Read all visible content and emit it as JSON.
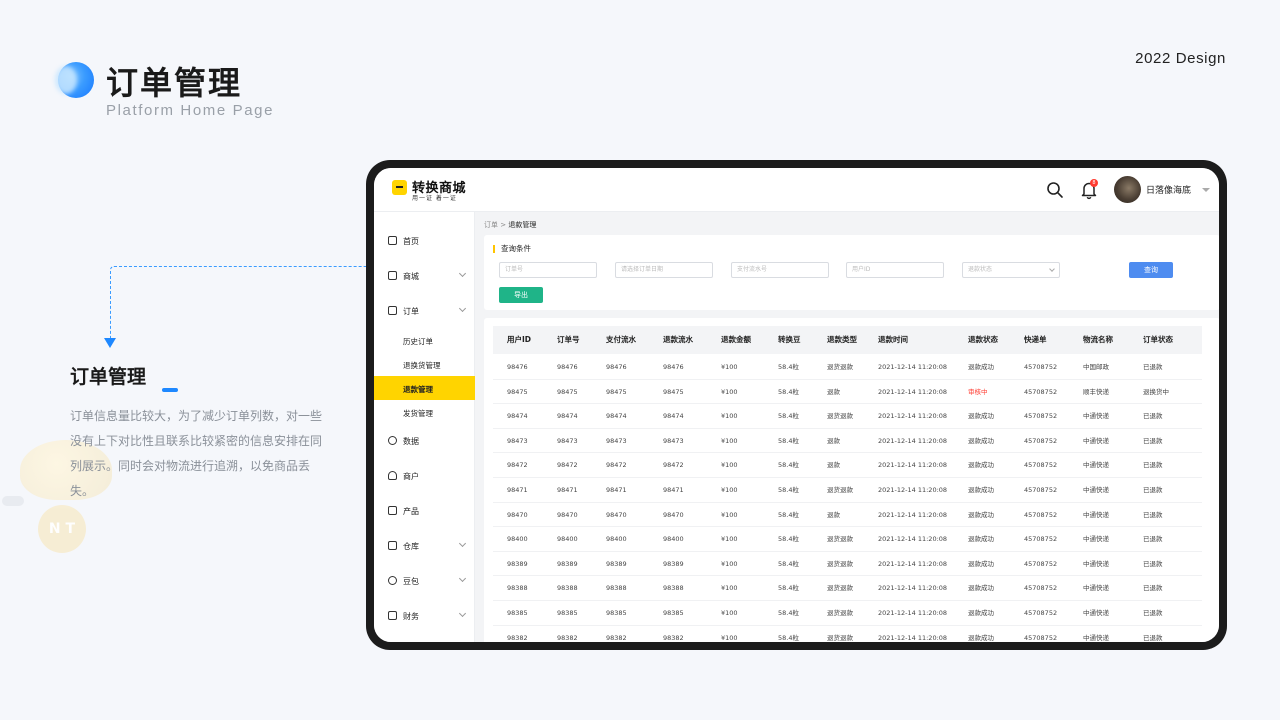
{
  "page": {
    "title": "订单管理",
    "subtitle": "Platform Home Page",
    "year_label": "2022 Design",
    "section_title": "订单管理",
    "section_desc": "订单信息量比较大，为了减少订单列数，对一些没有上下对比性且联系比较紧密的信息安排在同列展示。同时会对物流进行追溯，以免商品丢失。",
    "deco_coin_text": "N T"
  },
  "app": {
    "logo_title": "转换商城",
    "logo_sub": "用一证 着一证",
    "notification_count": "8",
    "user_name": "日落像海底"
  },
  "sidebar": {
    "items": [
      {
        "label": "首页",
        "icon": "home-icon",
        "has_children": false
      },
      {
        "label": "商城",
        "icon": "store-icon",
        "has_children": true
      },
      {
        "label": "订单",
        "icon": "order-icon",
        "has_children": true
      }
    ],
    "sub_items": [
      {
        "label": "历史订单",
        "active": false
      },
      {
        "label": "退换货管理",
        "active": false
      },
      {
        "label": "退款管理",
        "active": true
      },
      {
        "label": "发货管理",
        "active": false
      }
    ],
    "items_after": [
      {
        "label": "数据",
        "icon": "data-icon",
        "has_children": false
      },
      {
        "label": "商户",
        "icon": "merchant-icon",
        "has_children": false
      },
      {
        "label": "产品",
        "icon": "product-icon",
        "has_children": false
      },
      {
        "label": "仓库",
        "icon": "warehouse-icon",
        "has_children": true
      },
      {
        "label": "豆包",
        "icon": "bean-icon",
        "has_children": true
      },
      {
        "label": "财务",
        "icon": "finance-icon",
        "has_children": true
      }
    ]
  },
  "breadcrumb": {
    "parent": "订单",
    "separator": ">",
    "current": "退款管理"
  },
  "filter": {
    "title": "查询条件",
    "inputs": [
      {
        "placeholder": "订单号"
      },
      {
        "placeholder": "请选择订单日期"
      },
      {
        "placeholder": "支付流水号"
      },
      {
        "placeholder": "用户ID"
      },
      {
        "placeholder": "退款状态",
        "is_select": true
      }
    ],
    "query_label": "查询",
    "export_label": "导出"
  },
  "table": {
    "columns": [
      "用户ID",
      "订单号",
      "支付流水",
      "退款流水",
      "退款金额",
      "转换豆",
      "退款类型",
      "退款时间",
      "退款状态",
      "快递单",
      "物流名称",
      "订单状态"
    ],
    "rows": [
      [
        "98476",
        "98476",
        "98476",
        "98476",
        "¥100",
        "58.4粒",
        "退货退款",
        "2021-12-14 11:20:08",
        "退款成功",
        "45708752",
        "中国邮政",
        "已退款"
      ],
      [
        "98475",
        "98475",
        "98475",
        "98475",
        "¥100",
        "58.4粒",
        "退款",
        "2021-12-14 11:20:08",
        "审核中",
        "45708752",
        "顺丰快递",
        "退换货中"
      ],
      [
        "98474",
        "98474",
        "98474",
        "98474",
        "¥100",
        "58.4粒",
        "退货退款",
        "2021-12-14 11:20:08",
        "退款成功",
        "45708752",
        "中通快递",
        "已退款"
      ],
      [
        "98473",
        "98473",
        "98473",
        "98473",
        "¥100",
        "58.4粒",
        "退款",
        "2021-12-14 11:20:08",
        "退款成功",
        "45708752",
        "中通快递",
        "已退款"
      ],
      [
        "98472",
        "98472",
        "98472",
        "98472",
        "¥100",
        "58.4粒",
        "退款",
        "2021-12-14 11:20:08",
        "退款成功",
        "45708752",
        "中通快递",
        "已退款"
      ],
      [
        "98471",
        "98471",
        "98471",
        "98471",
        "¥100",
        "58.4粒",
        "退货退款",
        "2021-12-14 11:20:08",
        "退款成功",
        "45708752",
        "中通快递",
        "已退款"
      ],
      [
        "98470",
        "98470",
        "98470",
        "98470",
        "¥100",
        "58.4粒",
        "退款",
        "2021-12-14 11:20:08",
        "退款成功",
        "45708752",
        "中通快递",
        "已退款"
      ],
      [
        "98400",
        "98400",
        "98400",
        "98400",
        "¥100",
        "58.4粒",
        "退货退款",
        "2021-12-14 11:20:08",
        "退款成功",
        "45708752",
        "中通快递",
        "已退款"
      ],
      [
        "98389",
        "98389",
        "98389",
        "98389",
        "¥100",
        "58.4粒",
        "退货退款",
        "2021-12-14 11:20:08",
        "退款成功",
        "45708752",
        "中通快递",
        "已退款"
      ],
      [
        "98388",
        "98388",
        "98388",
        "98388",
        "¥100",
        "58.4粒",
        "退货退款",
        "2021-12-14 11:20:08",
        "退款成功",
        "45708752",
        "中通快递",
        "已退款"
      ],
      [
        "98385",
        "98385",
        "98385",
        "98385",
        "¥100",
        "58.4粒",
        "退货退款",
        "2021-12-14 11:20:08",
        "退款成功",
        "45708752",
        "中通快递",
        "已退款"
      ],
      [
        "98382",
        "98382",
        "98382",
        "98382",
        "¥100",
        "58.4粒",
        "退货退款",
        "2021-12-14 11:20:08",
        "退款成功",
        "45708752",
        "中通快递",
        "已退款"
      ]
    ],
    "highlight_status": "审核中"
  },
  "colors": {
    "accent_blue": "#1e88ff",
    "brand_yellow": "#ffd400",
    "query_blue": "#4e8cf0",
    "export_green": "#1fb488",
    "danger_red": "#ff3b30"
  }
}
